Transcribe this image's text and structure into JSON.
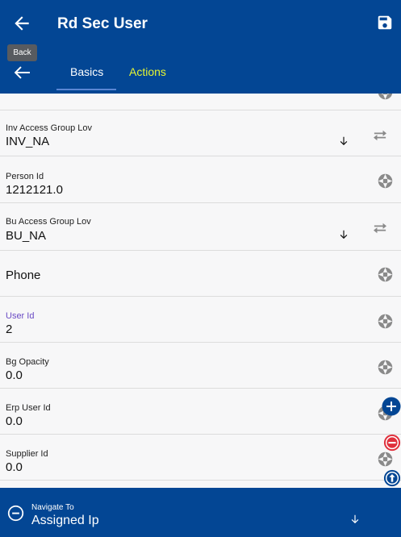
{
  "header": {
    "title": "Rd Sec User",
    "back_tooltip": "Back"
  },
  "tabs": [
    {
      "label": "Basics",
      "active": true
    },
    {
      "label": "Actions",
      "active": false
    }
  ],
  "fields": {
    "inv_access_group_lov": {
      "label": "Inv Access Group Lov",
      "value": "INV_NA"
    },
    "person_id": {
      "label": "Person Id",
      "value": "1212121.0"
    },
    "bu_access_group_lov": {
      "label": "Bu Access Group Lov",
      "value": "BU_NA"
    },
    "phone": {
      "label": "Phone"
    },
    "user_id": {
      "label": "User Id",
      "value": "2"
    },
    "bg_opacity": {
      "label": "Bg Opacity",
      "value": "0.0"
    },
    "erp_user_id": {
      "label": "Erp User Id",
      "value": "0.0"
    },
    "supplier_id": {
      "label": "Supplier Id",
      "value": "0.0"
    }
  },
  "navigate": {
    "label": "Navigate To",
    "value": "Assigned Ip"
  },
  "colors": {
    "primary": "#034694",
    "tab_actions": "#e6f533",
    "accent_label": "#6a4bc4",
    "fab_red": "#e0303c"
  }
}
